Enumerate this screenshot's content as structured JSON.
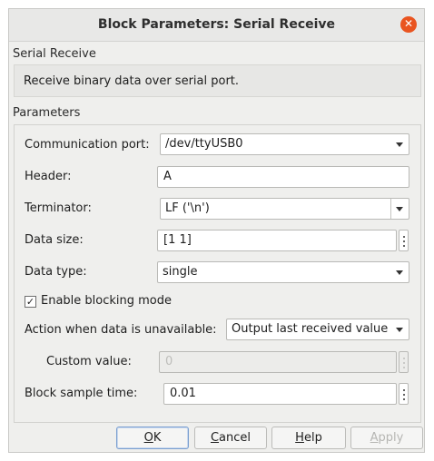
{
  "window": {
    "title": "Block Parameters: Serial Receive",
    "close_glyph": "✕"
  },
  "block": {
    "name": "Serial Receive",
    "description": "Receive binary data over serial port."
  },
  "parameters": {
    "section_label": "Parameters",
    "communication_port": {
      "label": "Communication port:",
      "value": "/dev/ttyUSB0"
    },
    "header": {
      "label": "Header:",
      "value": "A"
    },
    "terminator": {
      "label": "Terminator:",
      "value": "LF ('\\n')"
    },
    "data_size": {
      "label": "Data size:",
      "value": "[1  1]"
    },
    "data_type": {
      "label": "Data type:",
      "value": "single"
    },
    "enable_blocking": {
      "label": "Enable blocking mode",
      "checked": true,
      "check_glyph": "✓"
    },
    "action_unavailable": {
      "label": "Action when data is unavailable:",
      "value": "Output last received value"
    },
    "custom_value": {
      "label": "Custom value:",
      "value": "0"
    },
    "sample_time": {
      "label": "Block sample time:",
      "value": "0.01"
    }
  },
  "buttons": {
    "ok": {
      "mnemonic": "O",
      "rest": "K"
    },
    "cancel": {
      "mnemonic": "C",
      "rest": "ancel"
    },
    "help": {
      "mnemonic": "H",
      "rest": "elp"
    },
    "apply": {
      "mnemonic": "A",
      "rest": "pply"
    }
  },
  "colors": {
    "close_button": "#e95420",
    "dialog_bg": "#efefed",
    "default_button_border": "#7a9fd0"
  }
}
